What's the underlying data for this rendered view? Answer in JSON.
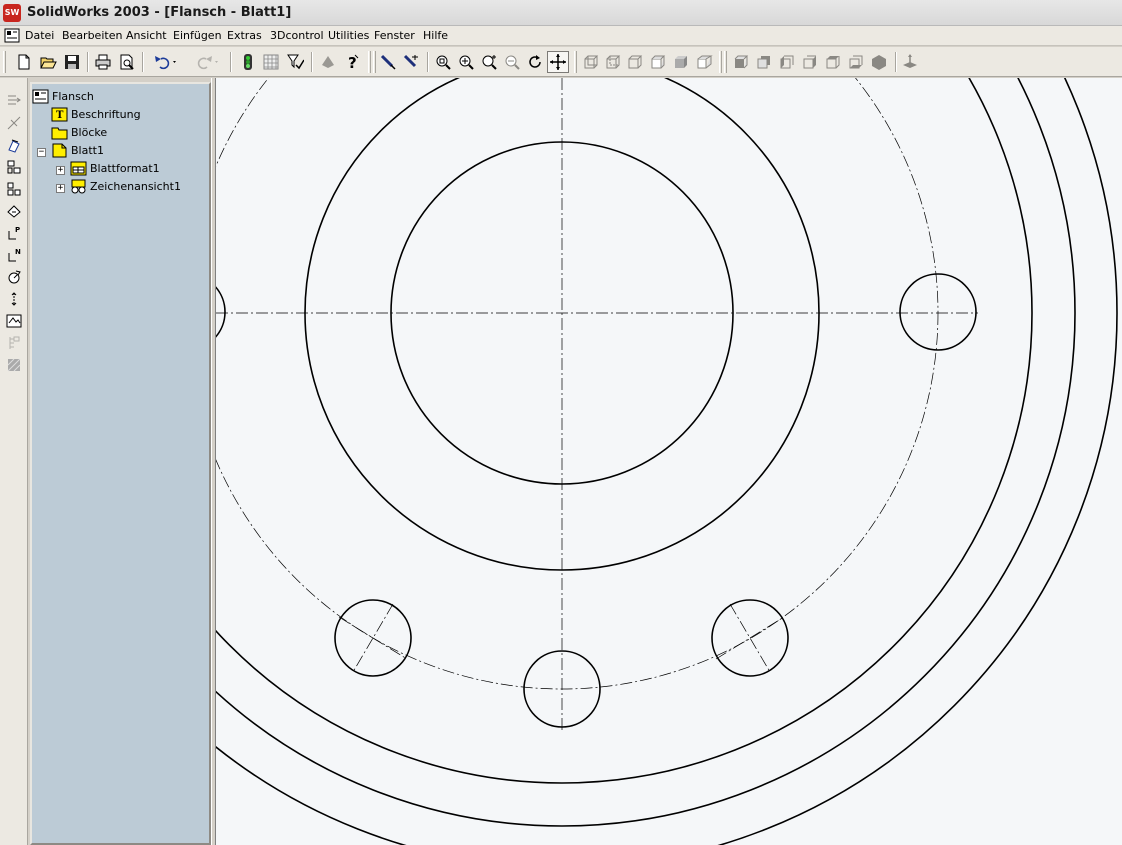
{
  "window": {
    "title": "SolidWorks 2003 - [Flansch - Blatt1]",
    "logo_text": "SW"
  },
  "menu": [
    "Datei",
    "Bearbeiten",
    "Ansicht",
    "Einfügen",
    "Extras",
    "3Dcontrol",
    "Utilities",
    "Fenster",
    "Hilfe"
  ],
  "toolbar": {
    "file": [
      "new-icon",
      "open-icon",
      "save-icon"
    ],
    "print": [
      "print-icon",
      "print-preview-icon"
    ],
    "edit": [
      "undo-icon",
      "redo-icon"
    ],
    "tools": [
      "rebuild-icon",
      "grid-icon",
      "selection-filter-icon",
      "options-icon",
      "help-icon"
    ],
    "view": [
      "zoom-to-fit-icon",
      "zoom-in-out-icon",
      "zoom-to-area-icon",
      "zoom-to-selection-icon",
      "rotate-view-icon",
      "pan-icon"
    ],
    "display": [
      "wireframe-icon",
      "hidden-lines-visible-icon",
      "hidden-lines-removed-icon",
      "shaded-with-edges-icon",
      "shaded-icon",
      "perspective-icon"
    ],
    "standard_views": [
      "front-view-icon",
      "back-view-icon",
      "left-view-icon",
      "right-view-icon",
      "top-view-icon",
      "isometric-view-icon",
      "normal-to-icon"
    ],
    "active_tool": "pan-icon"
  },
  "left_toolbar": [
    "model-view-icon",
    "projected-view-icon",
    "auxiliary-view-icon",
    "section-view-icon",
    "detail-view-icon",
    "crop-view-icon",
    "broken-out-view-icon",
    "break-view-icon",
    "alternate-position-icon",
    "relative-view-icon",
    "standard-3-view-icon",
    "named-view-icon",
    "hatch-icon"
  ],
  "tree": {
    "root": "Flansch",
    "items": [
      {
        "label": "Beschriftung",
        "icon": "annotations-icon"
      },
      {
        "label": "Blöcke",
        "icon": "blocks-folder-icon"
      },
      {
        "label": "Blatt1",
        "icon": "sheet-icon",
        "expanded": true
      },
      {
        "label": "Blattformat1",
        "icon": "sheet-format-icon",
        "expandable": true
      },
      {
        "label": "Zeichenansicht1",
        "icon": "drawing-view-icon",
        "expandable": true
      }
    ]
  },
  "drawing": {
    "center_x_in": "Flansch",
    "line_color": "#000000",
    "background": "#f5f7f9"
  }
}
